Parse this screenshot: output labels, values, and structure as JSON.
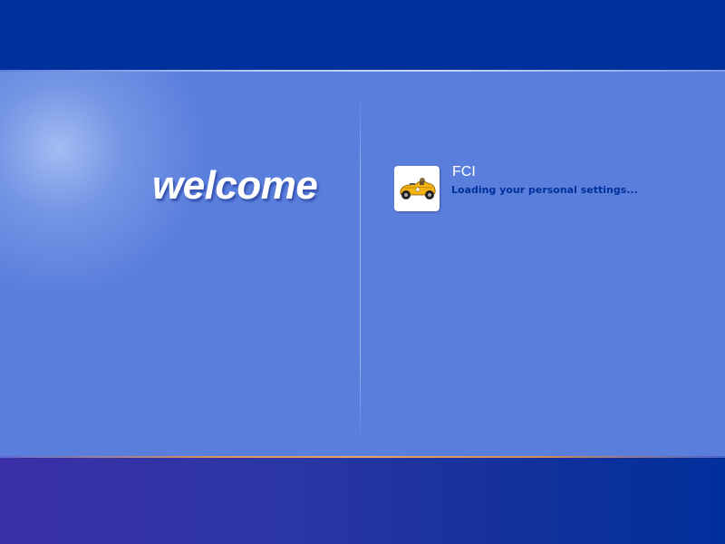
{
  "welcome": {
    "text": "welcome"
  },
  "user": {
    "name": "FCI",
    "status": "Loading your personal settings...",
    "avatar_icon": "race-car-icon"
  },
  "colors": {
    "top_bar": "#00309c",
    "main_background": "#5a7edc",
    "status_text": "#00309c",
    "bottom_accent": "#f0a060"
  }
}
